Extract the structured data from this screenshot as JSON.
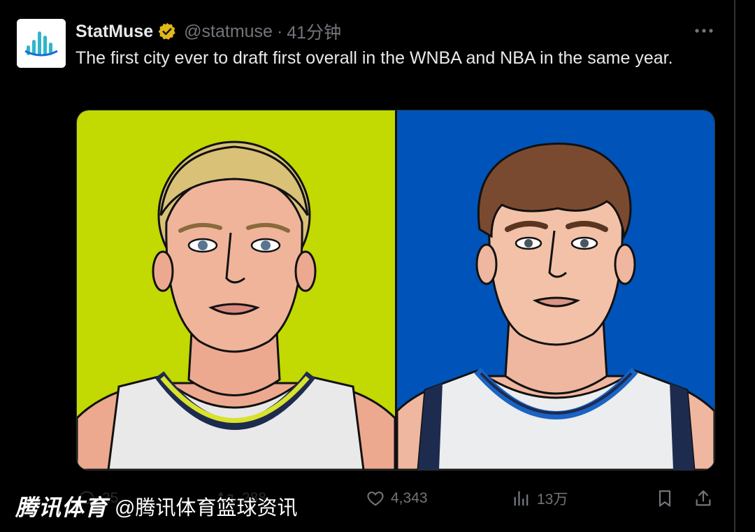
{
  "tweet": {
    "display_name": "StatMuse",
    "handle": "@statmuse",
    "separator": "·",
    "time": "41分钟",
    "text": "The first city ever to draft first overall in the WNBA and NBA in the same year.",
    "verified_color": "#e2b719"
  },
  "media": {
    "left_bg": "#c2d902",
    "right_bg": "#0053b8"
  },
  "actions": {
    "replies": "25",
    "reposts": "288",
    "likes": "4,343",
    "views": "13万"
  },
  "watermark": {
    "logo": "腾讯体育",
    "account": "@腾讯体育篮球资讯"
  },
  "icons": [
    "statmuse-logo-icon",
    "verified-badge-icon",
    "more-icon",
    "reply-icon",
    "repost-icon",
    "like-icon",
    "views-icon",
    "bookmark-icon",
    "share-icon"
  ]
}
